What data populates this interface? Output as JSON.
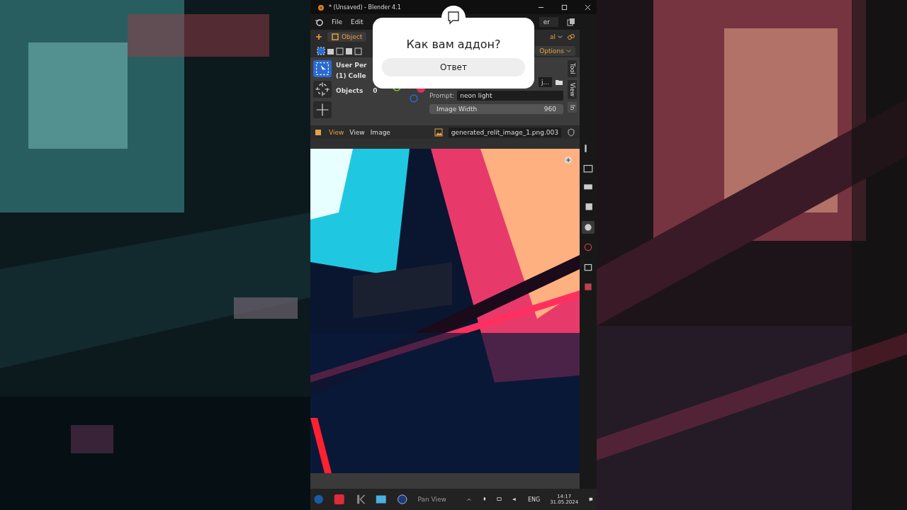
{
  "window": {
    "title": "* (Unsaved) - Blender 4.1"
  },
  "menu": [
    {
      "label": "File"
    },
    {
      "label": "Edit"
    }
  ],
  "scene_field": {
    "value": "er"
  },
  "header": {
    "mode": "Object",
    "orientation": "al",
    "options": "Options"
  },
  "viewport": {
    "view_name": "User Per",
    "collection": "(1) Colle",
    "stats_label": "Objects",
    "stats_value": "0"
  },
  "addon_panel": {
    "file_value": "j...",
    "prompt_label": "Prompt:",
    "prompt_value": "neon light",
    "width_label": "Image Width",
    "width_value": "960"
  },
  "side_tabs": [
    {
      "label": "Tool",
      "selected": false
    },
    {
      "label": "View",
      "selected": false
    },
    {
      "label": "In",
      "selected": true
    }
  ],
  "properties_tabs": [
    {
      "kind": "tool",
      "selected": false
    },
    {
      "kind": "render",
      "selected": false
    },
    {
      "kind": "output",
      "selected": false
    },
    {
      "kind": "view_layer",
      "selected": false
    },
    {
      "kind": "scene",
      "selected": true
    },
    {
      "kind": "world",
      "selected": false
    },
    {
      "kind": "collection",
      "selected": false
    },
    {
      "kind": "texture",
      "selected": false
    }
  ],
  "image_editor": {
    "menus": [
      {
        "label": "View",
        "selected": true
      },
      {
        "label": "View",
        "selected": false
      },
      {
        "label": "Image",
        "selected": false
      }
    ],
    "image_name": "generated_relit_image_1.png.003"
  },
  "popup": {
    "question": "Как вам аддон?",
    "button": "Ответ"
  },
  "taskbar": {
    "apps": [
      {
        "kind": "steam"
      },
      {
        "kind": "timer"
      },
      {
        "kind": "k"
      },
      {
        "kind": "chart"
      },
      {
        "kind": "w"
      }
    ],
    "status_hint": "Pan View",
    "language": "ENG",
    "time": "14:17",
    "date": "31.05.2024"
  }
}
